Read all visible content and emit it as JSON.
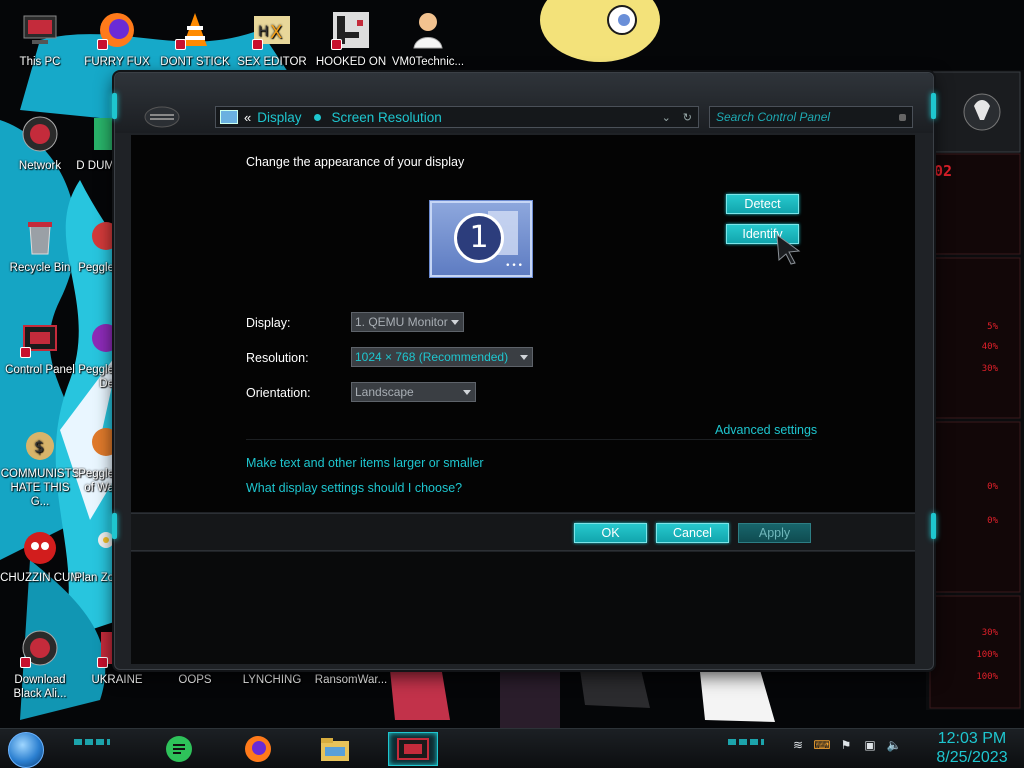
{
  "desktop": {
    "icons": [
      {
        "label": "This PC"
      },
      {
        "label": "FURRY FUX"
      },
      {
        "label": "DONT STICK"
      },
      {
        "label": "SEX EDITOR"
      },
      {
        "label": "HOOKED ON"
      },
      {
        "label": "VM0Technic..."
      },
      {
        "label": "Network"
      },
      {
        "label": "D DUM"
      },
      {
        "label": "Recycle Bin"
      },
      {
        "label": "Peggle"
      },
      {
        "label": "Control Panel"
      },
      {
        "label": "Peggle De"
      },
      {
        "label": "COMMUNISTS HATE THIS G..."
      },
      {
        "label": "Peggle of Wa"
      },
      {
        "label": "CHUZZIN CUM"
      },
      {
        "label": "Plan Zo"
      },
      {
        "label": "Download Black Ali..."
      },
      {
        "label": "UKRAINE"
      },
      {
        "label": "OOPS"
      },
      {
        "label": "LYNCHING"
      },
      {
        "label": "RansomWar..."
      }
    ]
  },
  "window": {
    "breadcrumb": {
      "back": "«",
      "items": [
        "Display",
        "Screen Resolution"
      ]
    },
    "search_placeholder": "Search Control Panel",
    "heading": "Change the appearance of your display",
    "monitor_number": "1",
    "detect_label": "Detect",
    "identify_label": "Identify",
    "form": {
      "display_label": "Display:",
      "display_value": "1. QEMU Monitor",
      "resolution_label": "Resolution:",
      "resolution_value": "1024 × 768 (Recommended)",
      "orientation_label": "Orientation:",
      "orientation_value": "Landscape"
    },
    "advanced_link": "Advanced settings",
    "link_text_size": "Make text and other items larger or smaller",
    "link_help": "What display settings should I choose?",
    "ok_label": "OK",
    "cancel_label": "Cancel",
    "apply_label": "Apply"
  },
  "gadget": {
    "top_value": "02",
    "percents": [
      "5%",
      "40%",
      "30%",
      "0%",
      "0%",
      "30%",
      "100%",
      "100%"
    ]
  },
  "taskbar": {
    "apps": [
      "start-orb",
      "notes",
      "firefox",
      "file-explorer",
      "control-panel"
    ],
    "clock_time": "12:03 PM",
    "clock_date": "8/25/2023"
  },
  "colors": {
    "accent": "#1ec6cf",
    "window": "#1f2226",
    "content": "#040404"
  }
}
